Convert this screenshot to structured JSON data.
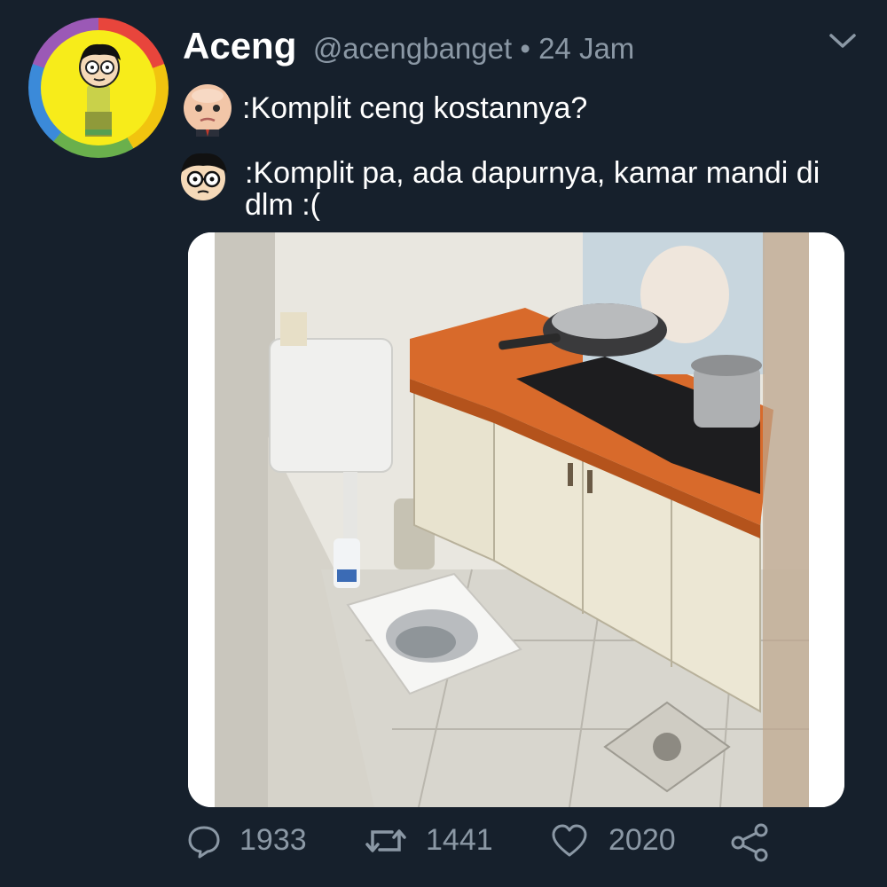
{
  "tweet": {
    "author_name": "Aceng",
    "author_handle": "@acengbanget",
    "separator": "•",
    "time": "24 Jam"
  },
  "messages": [
    {
      "speaker_icon": "baby-face-icon",
      "text": ":Komplit ceng kostannya?"
    },
    {
      "speaker_icon": "aceng-face-icon",
      "text": ":Komplit pa, ada dapurnya, kamar mandi di dlm :("
    }
  ],
  "stats": {
    "replies": "1933",
    "retweets": "1441",
    "likes": "2020"
  },
  "colors": {
    "background": "#16202c",
    "muted": "#8b98a5",
    "text": "#ffffff"
  },
  "icons": [
    "reply-icon",
    "retweet-icon",
    "like-icon",
    "share-icon",
    "chevron-down-icon"
  ]
}
